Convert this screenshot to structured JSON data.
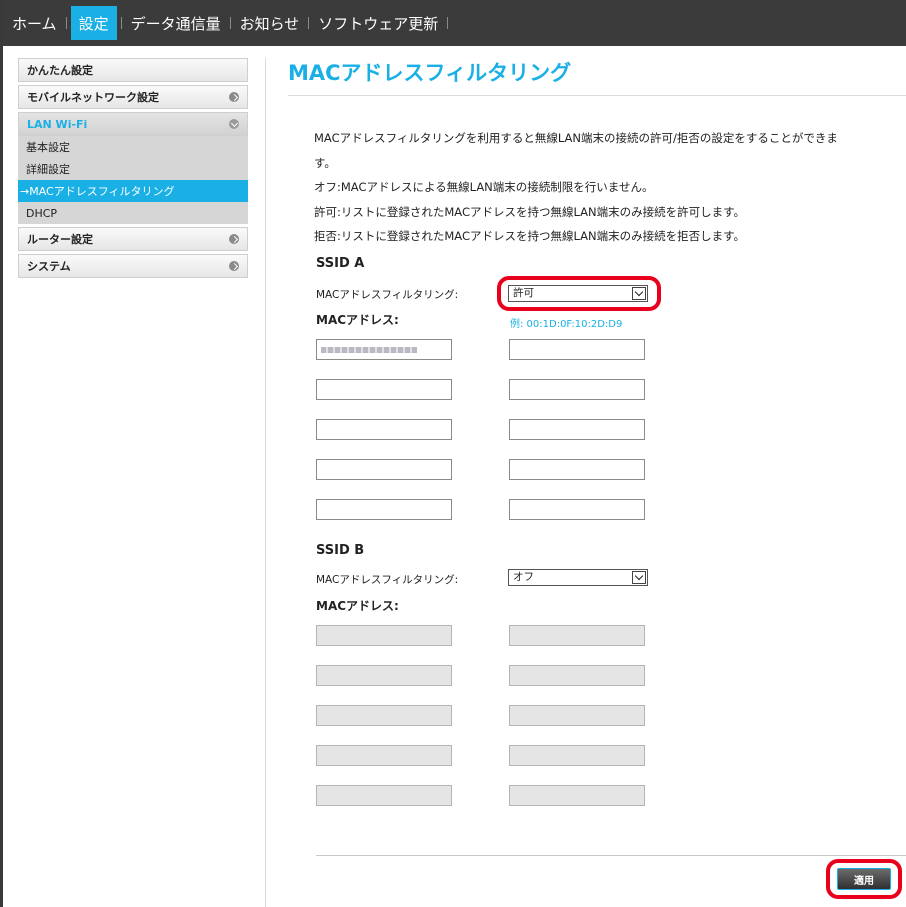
{
  "nav": {
    "items": [
      "ホーム",
      "設定",
      "データ通信量",
      "お知らせ",
      "ソフトウェア更新"
    ],
    "active": "設定"
  },
  "sidebar": {
    "quick_setup": "かんたん設定",
    "mobile_network": "モバイルネットワーク設定",
    "lan_wifi": "LAN Wi-Fi",
    "lan_sub": {
      "basic": "基本設定",
      "detail": "詳細設定",
      "mac_filter": "→MACアドレスフィルタリング",
      "dhcp": "DHCP"
    },
    "router": "ルーター設定",
    "system": "システム"
  },
  "main": {
    "title": "MACアドレスフィルタリング",
    "desc_line1": "MACアドレスフィルタリングを利用すると無線LAN端末の接続の許可/拒否の設定をすることができま",
    "desc_line2": "す。",
    "desc_line3": "オフ:MACアドレスによる無線LAN端末の接続制限を行いません。",
    "desc_line4": "許可:リストに登録されたMACアドレスを持つ無線LAN端末のみ接続を許可します。",
    "desc_line5": "拒否:リストに登録されたMACアドレスを持つ無線LAN端末のみ接続を拒否します。",
    "ssid_a": {
      "title": "SSID A",
      "filter_label": "MACアドレスフィルタリング:",
      "filter_value": "許可",
      "mac_label": "MACアドレス:",
      "example": "例: 00:1D:0F:10:2D:D9"
    },
    "ssid_b": {
      "title": "SSID B",
      "filter_label": "MACアドレスフィルタリング:",
      "filter_value": "オフ",
      "mac_label": "MACアドレス:"
    },
    "apply_label": "適用"
  },
  "colors": {
    "accent": "#1ab0e6",
    "nav_bg": "#3b3b3b",
    "highlight": "#e8001c"
  }
}
